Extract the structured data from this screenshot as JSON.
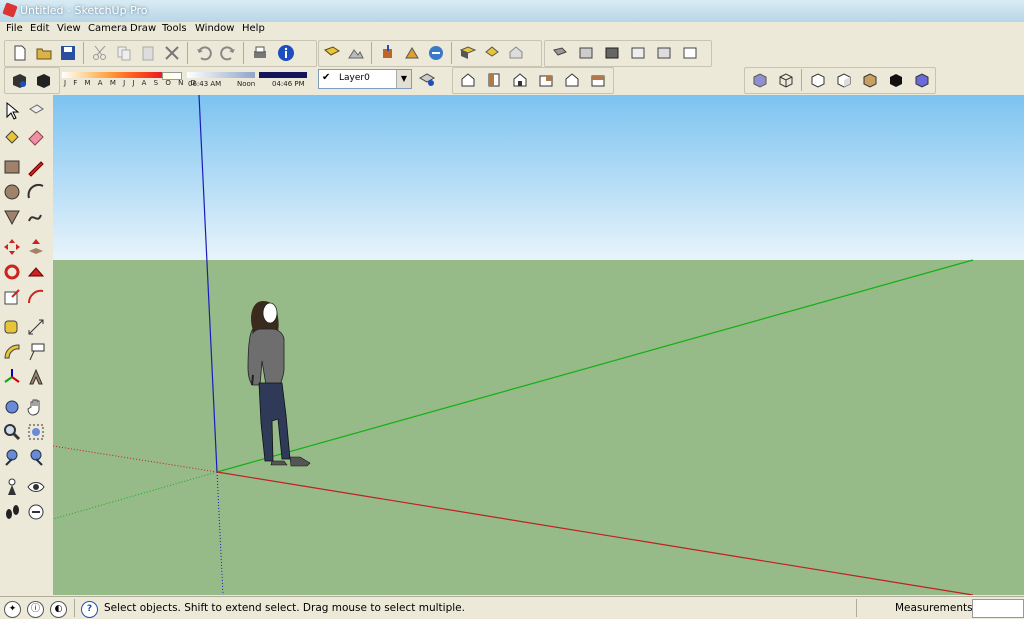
{
  "window": {
    "title": "Untitled - SketchUp Pro"
  },
  "menu": [
    "File",
    "Edit",
    "View",
    "Camera",
    "Draw",
    "Tools",
    "Window",
    "Help"
  ],
  "shadow_settings": {
    "months": "J F M A M J J A S O N D",
    "time_start": "06:43 AM",
    "time_mid": "Noon",
    "time_end": "04:46 PM"
  },
  "layers": {
    "current": "Layer0"
  },
  "status": {
    "hint": "Select objects. Shift to extend select. Drag mouse to select multiple.",
    "measurements_label": "Measurements",
    "measurements_value": ""
  },
  "colors": {
    "sky_top": "#7cc3f0",
    "ground": "#97ba89",
    "red_axis": "#c00000",
    "green_axis": "#00b000",
    "blue_axis": "#0000c0"
  }
}
